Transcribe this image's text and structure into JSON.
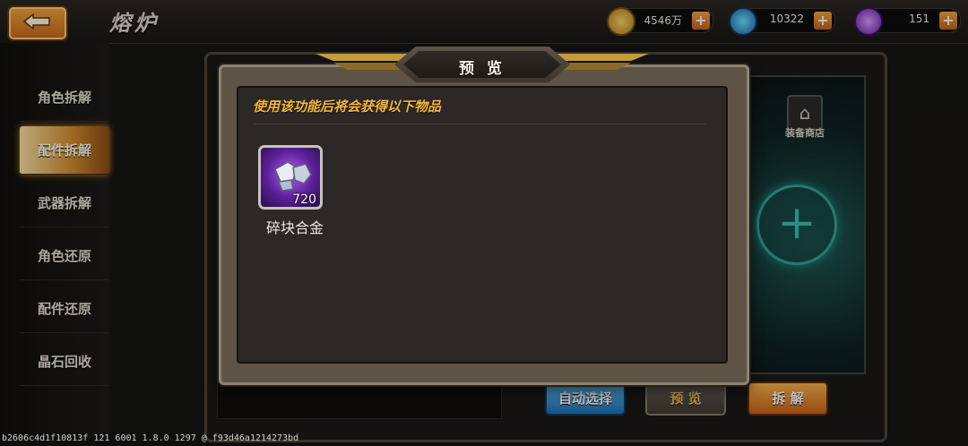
{
  "header": {
    "title": "熔炉",
    "resources": [
      {
        "icon": "gold-coin-icon",
        "value": "4546万"
      },
      {
        "icon": "blue-gem-icon",
        "value": "10322"
      },
      {
        "icon": "purple-crystal-icon",
        "value": "151"
      }
    ]
  },
  "sidebar": {
    "items": [
      {
        "label": "角色拆解",
        "active": false
      },
      {
        "label": "配件拆解",
        "active": true
      },
      {
        "label": "武器拆解",
        "active": false
      },
      {
        "label": "角色还原",
        "active": false
      },
      {
        "label": "配件还原",
        "active": false
      },
      {
        "label": "晶石回收",
        "active": false
      }
    ]
  },
  "background": {
    "shop_label": "装备商店",
    "buttons": {
      "auto_select": "自动选择",
      "preview": "预 览",
      "dismantle": "拆 解"
    }
  },
  "modal": {
    "title": "预 览",
    "description": "使用该功能后将会获得以下物品",
    "items": [
      {
        "name": "碎块合金",
        "count": "720",
        "icon": "alloy-chunk-icon"
      }
    ]
  },
  "footer": {
    "debug_text": "b2606c4d1f10813f 121 6001 1.8.0 1297 @ f93d46a1214273bd"
  },
  "colors": {
    "accent_orange": "#f6b73c",
    "item_purple": "#b05cf1"
  }
}
